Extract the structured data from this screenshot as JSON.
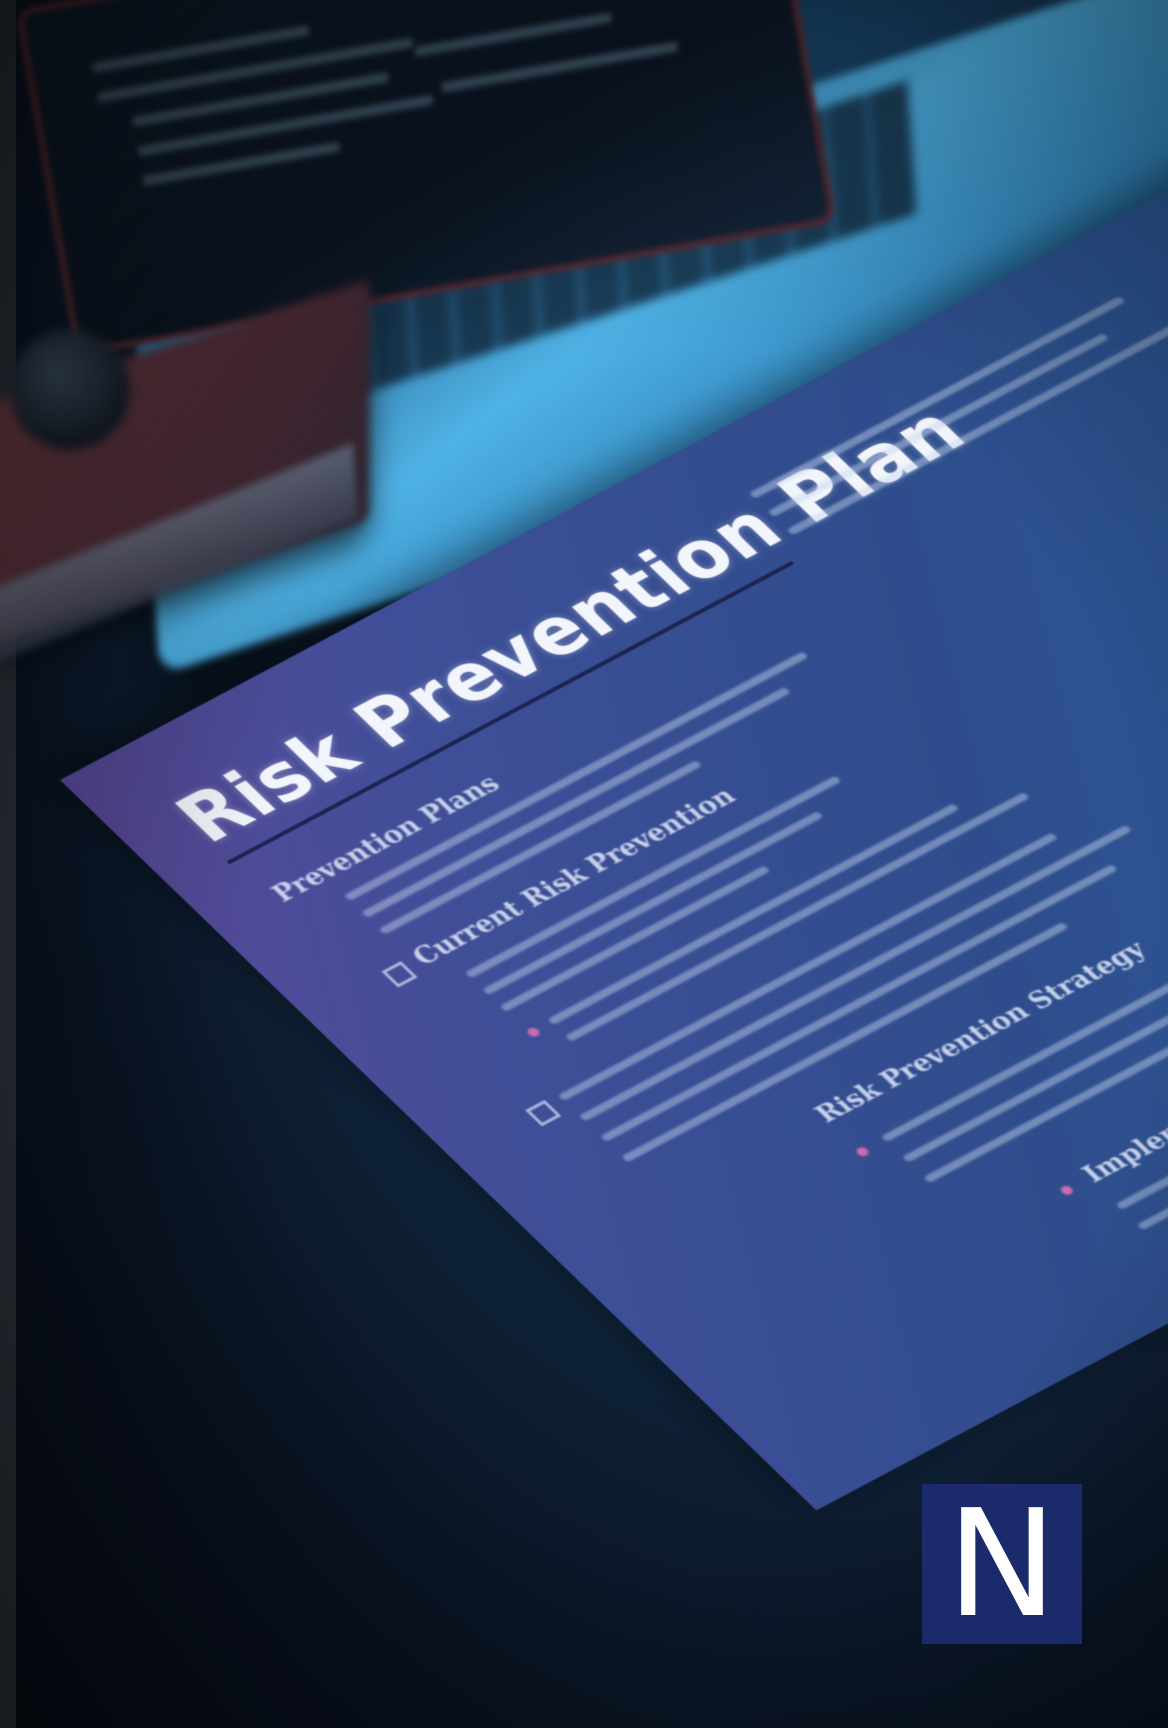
{
  "document": {
    "title": "Risk Prevention Plan",
    "headings": [
      "Prevention Plans",
      "Current Risk Prevention",
      "Risk Prevention Strategy",
      "Implementation"
    ]
  },
  "logo": {
    "letter": "N",
    "background": "#1b2a6b",
    "color": "#ffffff"
  },
  "colors": {
    "left_strip": "#2a3038",
    "document_gradient_start": "#5b4a9a",
    "document_gradient_end": "#2f6cab",
    "bullet_accent": "#d06bb0"
  }
}
